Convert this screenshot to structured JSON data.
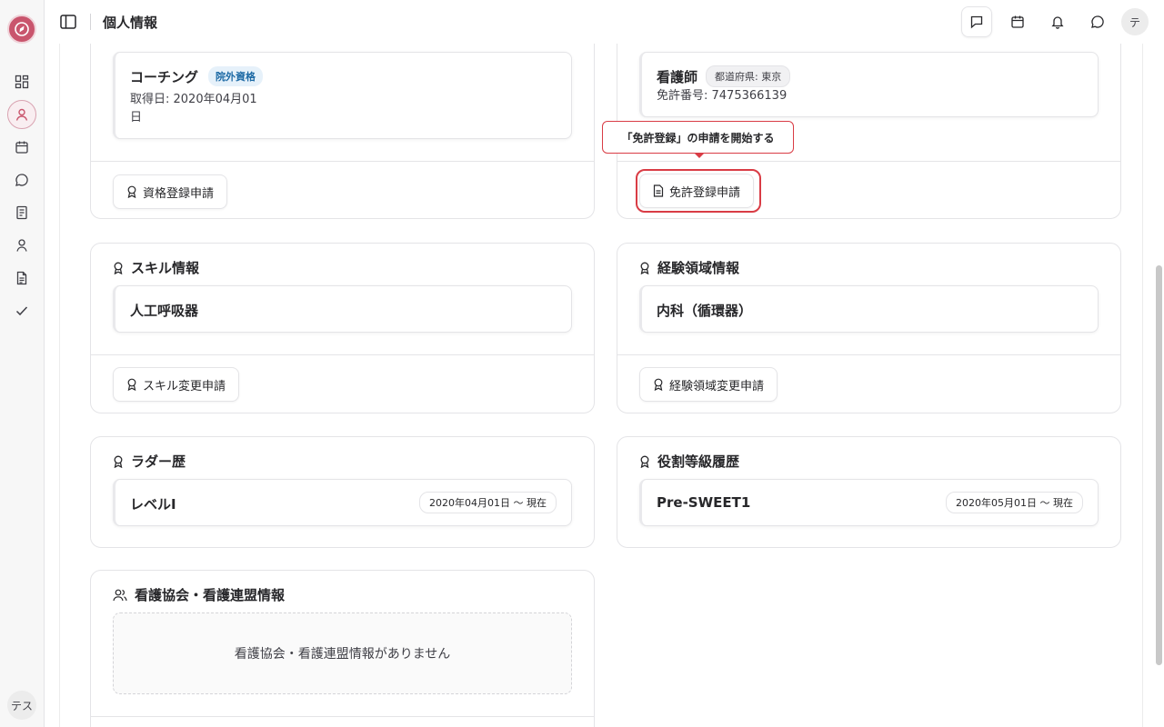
{
  "header": {
    "title": "個人情報",
    "avatar_label": "テ"
  },
  "rail": {
    "user_label": "テス"
  },
  "qualification_card": {
    "item": {
      "name": "コーチング",
      "tag": "院外資格",
      "acquired_line1": "取得日: 2020年04月01",
      "acquired_line2": "日"
    },
    "button_label": "資格登録申請"
  },
  "license_card": {
    "item": {
      "name": "看護師",
      "tag": "都道府県: 東京",
      "license_number": "免許番号: 7475366139"
    },
    "button_label": "免許登録申請",
    "tooltip": "「免許登録」の申請を開始する"
  },
  "skill_card": {
    "title": "スキル情報",
    "item": "人工呼吸器",
    "button_label": "スキル変更申請"
  },
  "experience_card": {
    "title": "経験領域情報",
    "item": "内科（循環器）",
    "button_label": "経験領域変更申請"
  },
  "ladder_card": {
    "title": "ラダー歴",
    "item": "レベルI",
    "period": "2020年04月01日 〜 現在"
  },
  "role_card": {
    "title": "役割等級履歴",
    "item": "Pre-SWEET1",
    "period": "2020年05月01日 〜 現在"
  },
  "association_card": {
    "title": "看護協会・看護連盟情報",
    "empty_message": "看護協会・看護連盟情報がありません"
  },
  "colors": {
    "brand": "#c9556d",
    "highlight": "#d93c45",
    "tag_blue_text": "#1d6aa5",
    "tag_blue_bg": "#e6f1fa"
  }
}
